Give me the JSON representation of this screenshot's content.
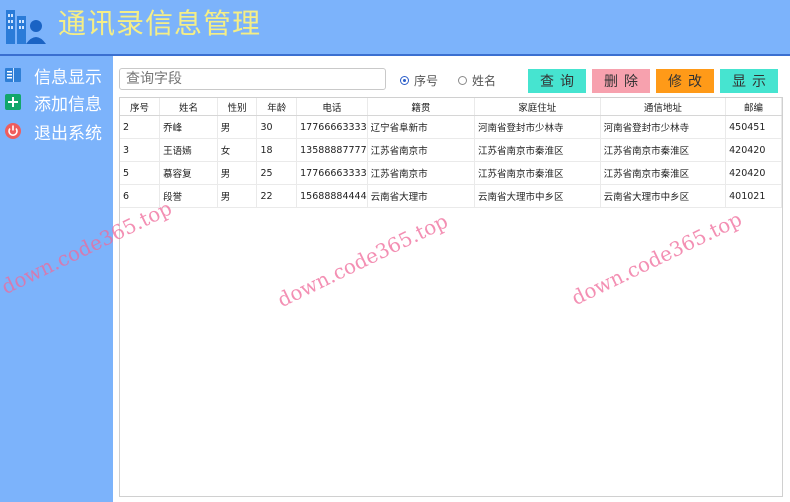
{
  "header": {
    "title": "通讯录信息管理",
    "icon": "building-user-icon"
  },
  "sidebar": {
    "items": [
      {
        "label": "信息显示",
        "icon": "list-book-icon",
        "color": "#2f7fd6"
      },
      {
        "label": "添加信息",
        "icon": "plus-square-icon",
        "color": "#12a66a"
      },
      {
        "label": "退出系统",
        "icon": "power-icon",
        "color": "#ef5d5d"
      }
    ]
  },
  "search": {
    "placeholder": "查询字段",
    "value": ""
  },
  "radios": [
    {
      "label": "序号",
      "checked": true
    },
    {
      "label": "姓名",
      "checked": false
    }
  ],
  "buttons": [
    {
      "label": "查询",
      "color": "#46e4d0"
    },
    {
      "label": "删除",
      "color": "#f7a1ae"
    },
    {
      "label": "修改",
      "color": "#ff9a18"
    },
    {
      "label": "显示",
      "color": "#46e4d0"
    }
  ],
  "table": {
    "headers": [
      "序号",
      "姓名",
      "性别",
      "年龄",
      "电话",
      "籍贯",
      "家庭住址",
      "通信地址",
      "邮编"
    ],
    "rows": [
      [
        "2",
        "乔峰",
        "男",
        "30",
        "17766663333",
        "辽宁省阜新市",
        "河南省登封市少林寺",
        "河南省登封市少林寺",
        "450451"
      ],
      [
        "3",
        "王语嫣",
        "女",
        "18",
        "13588887777",
        "江苏省南京市",
        "江苏省南京市秦淮区",
        "江苏省南京市秦淮区",
        "420420"
      ],
      [
        "5",
        "慕容复",
        "男",
        "25",
        "17766663333",
        "江苏省南京市",
        "江苏省南京市秦淮区",
        "江苏省南京市秦淮区",
        "420420"
      ],
      [
        "6",
        "段誉",
        "男",
        "22",
        "15688884444",
        "云南省大理市",
        "云南省大理市中乡区",
        "云南省大理市中乡区",
        "401021"
      ]
    ]
  },
  "watermark": "down.code365.top"
}
